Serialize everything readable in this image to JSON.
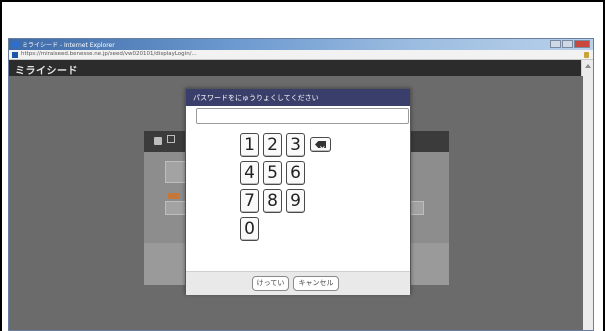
{
  "browser": {
    "title": "ミライシード - Internet Explorer",
    "url_host": "benesse.ne.jp",
    "url_path": "https://miraiseed.benesse.ne.jp/seed/vw020101/displayLogin/..."
  },
  "app": {
    "logo": "ミライシード"
  },
  "dialog": {
    "title": "パスワードをにゅうりょくしてください",
    "input_value": "",
    "keypad": {
      "rows": [
        [
          "1",
          "2",
          "3"
        ],
        [
          "4",
          "5",
          "6"
        ],
        [
          "7",
          "8",
          "9"
        ],
        [
          "0"
        ]
      ]
    },
    "confirm_label": "けってい",
    "cancel_label": "キャンセル"
  },
  "icons": {
    "backspace": "backspace-icon",
    "lock": "lock-icon",
    "browser": "ie-icon"
  },
  "colors": {
    "dialog_header": "#3a3e6a",
    "app_header": "#2c2c2c",
    "overlay": "#6b6b6b"
  }
}
